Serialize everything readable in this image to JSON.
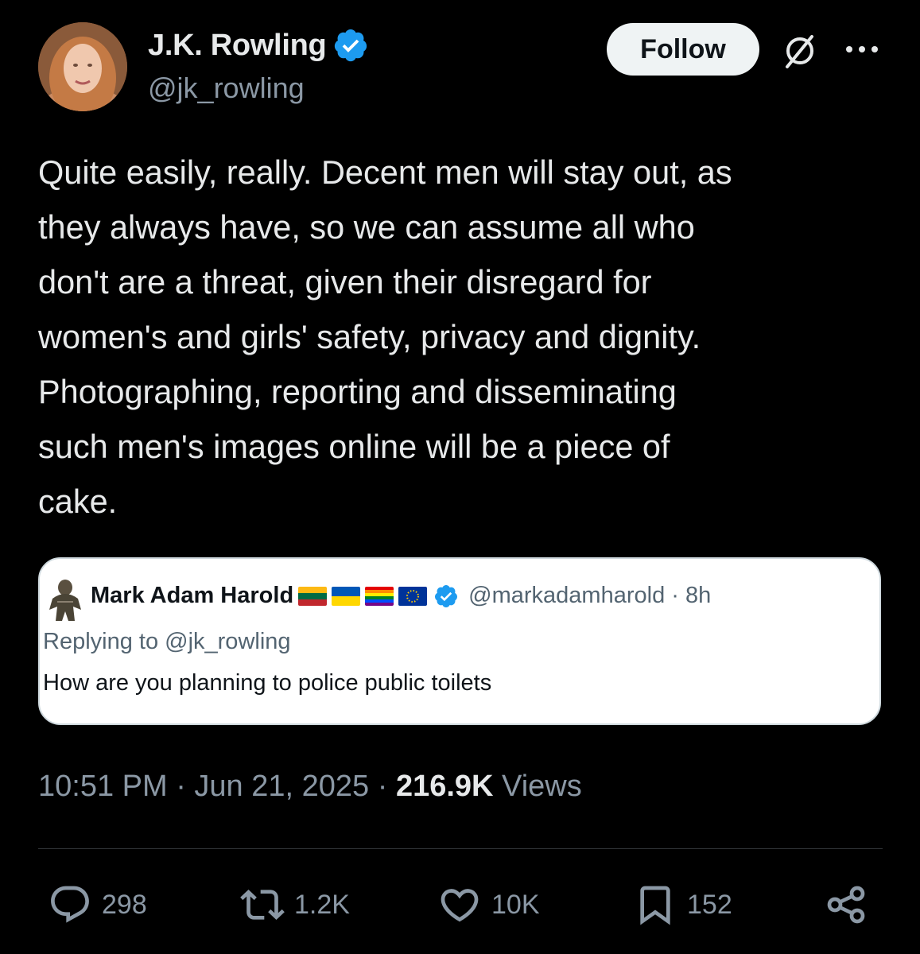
{
  "author": {
    "display_name": "J.K. Rowling",
    "handle": "@jk_rowling",
    "verified": true,
    "verified_color": "#1d9bf0"
  },
  "header_actions": {
    "follow_label": "Follow",
    "grok_icon": "grok-icon",
    "more_icon": "more-icon"
  },
  "tweet": {
    "text": "Quite easily, really. Decent men will stay out, as\nthey always have, so we can assume all who\ndon't are a threat, given their disregard for\nwomen's and girls' safety, privacy and dignity.\nPhotographing, reporting and disseminating\nsuch men's images online will be a piece of\ncake."
  },
  "quoted": {
    "display_name": "Mark Adam Harold",
    "flags": [
      "lithuania-flag",
      "ukraine-flag",
      "rainbow-flag",
      "eu-flag"
    ],
    "verified": true,
    "handle_time": "@markadamharold · 8h",
    "replying_to": "Replying to @jk_rowling",
    "text": "How are you planning to police public toilets"
  },
  "meta": {
    "time": "10:51 PM · Jun 21, 2025 · ",
    "views_count": "216.9K",
    "views_label": " Views"
  },
  "actions": {
    "replies": "298",
    "reposts": "1.2K",
    "likes": "10K",
    "bookmarks": "152"
  },
  "colors": {
    "background": "#000000",
    "text": "#e7e9ea",
    "secondary": "#8b98a5",
    "accent": "#1d9bf0"
  }
}
